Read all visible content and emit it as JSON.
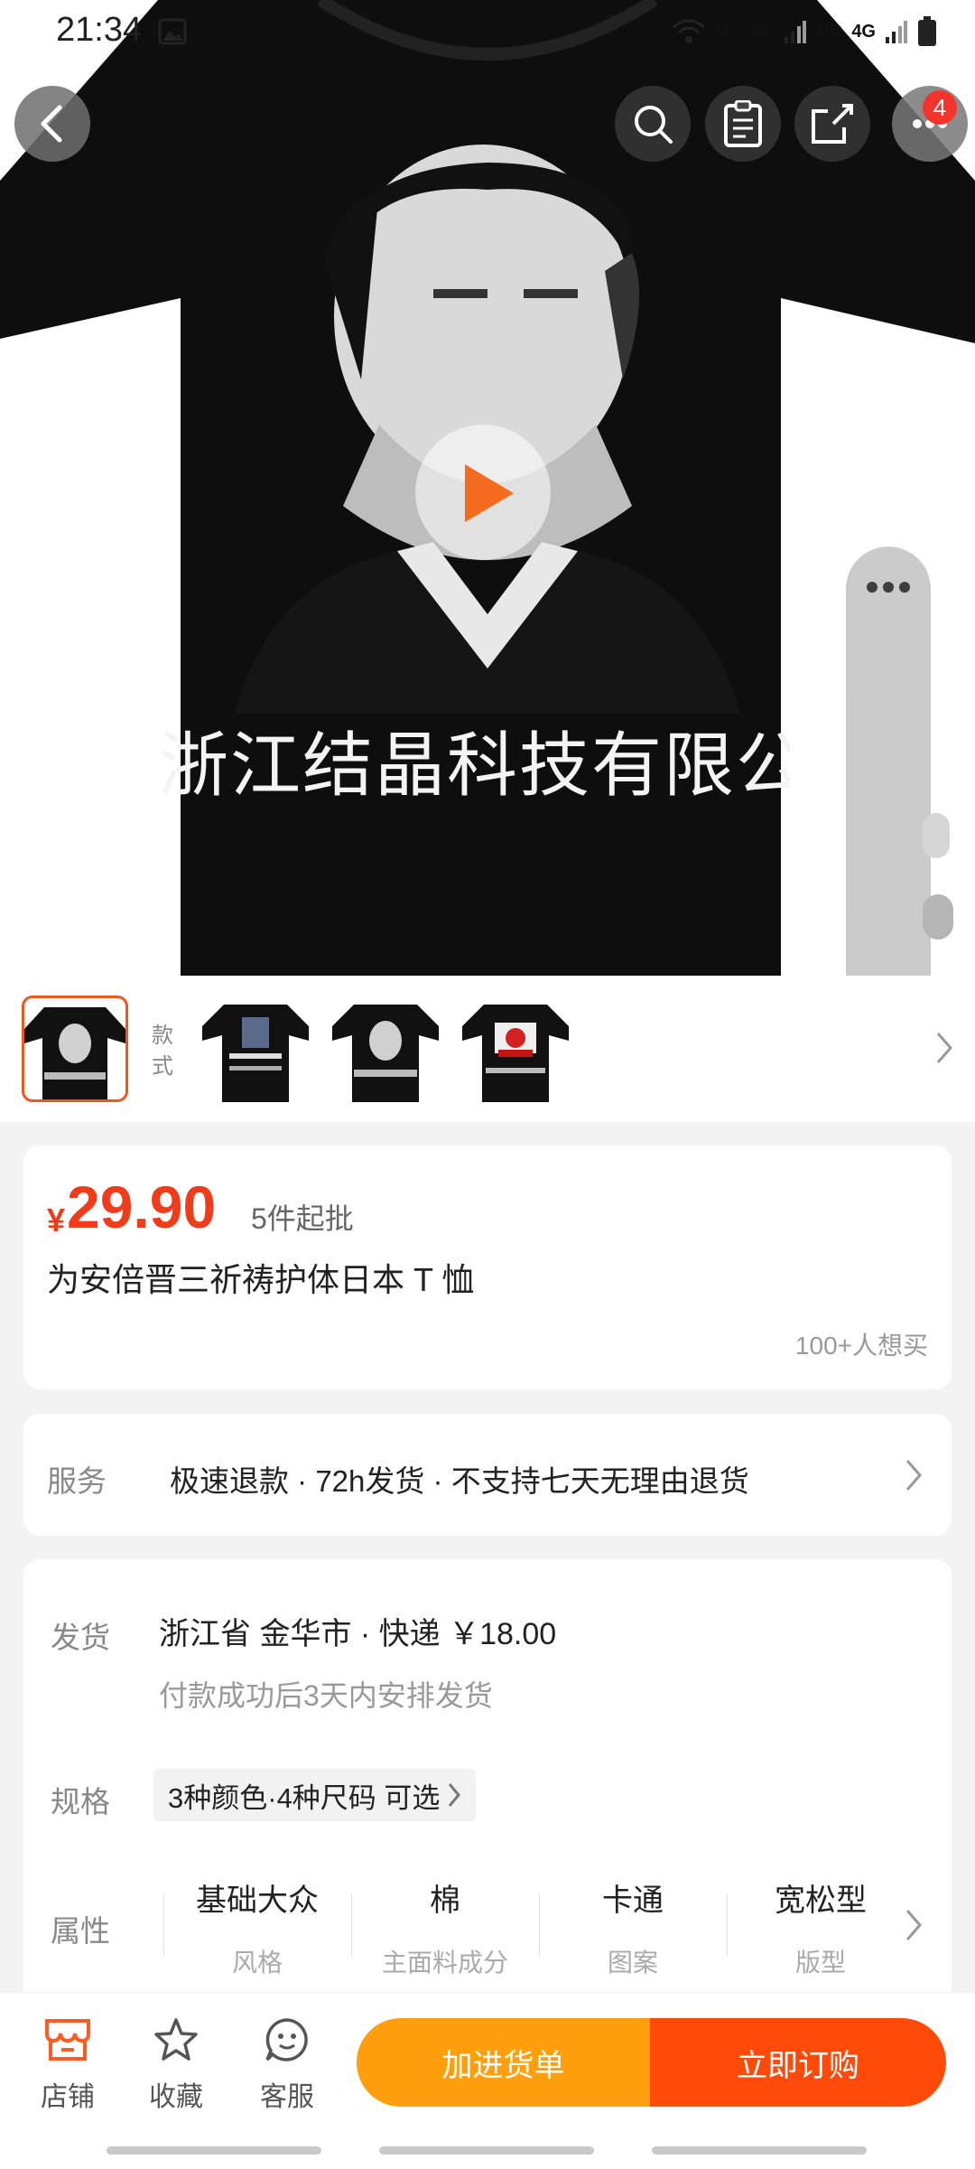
{
  "status_bar": {
    "time": "21:34",
    "net1": "HD",
    "net2": "4G",
    "net3": "HD",
    "net4": "4G"
  },
  "top_actions": {
    "cart_badge": "4"
  },
  "hero": {
    "shirt_text": "浙江结晶科技有限公司"
  },
  "thumbnails": {
    "style_label": "款式",
    "thumb2_caption": "PRAY FOR SHINZO ABE",
    "thumb4_caption": "JAPAN",
    "thumb_small_text": "江结晶科技有限公"
  },
  "price_card": {
    "currency": "¥",
    "price": "29.90",
    "moq": "5件起批",
    "title": "为安倍晋三祈祷护体日本 T 恤",
    "want": "100+人想买"
  },
  "service": {
    "label": "服务",
    "text": "极速退款 · 72h发货 · 不支持七天无理由退货"
  },
  "shipping": {
    "label": "发货",
    "origin": "浙江省 金华市  ·  快递 ￥18.00",
    "note": "付款成功后3天内安排发货",
    "spec_label": "规格",
    "spec_value": "3种颜色·4种尺码 可选",
    "attr_label": "属性",
    "attributes": [
      {
        "value": "基础大众",
        "key": "风格"
      },
      {
        "value": "棉",
        "key": "主面料成分"
      },
      {
        "value": "卡通",
        "key": "图案"
      },
      {
        "value": "宽松型",
        "key": "版型"
      }
    ]
  },
  "bottom_bar": {
    "shop": "店铺",
    "favorite": "收藏",
    "service": "客服",
    "add_to_cart": "加进货单",
    "buy_now": "立即订购"
  },
  "colors": {
    "accent_red": "#f13c1c",
    "orange": "#ff9f0d",
    "orange_red": "#ff4a0a"
  }
}
